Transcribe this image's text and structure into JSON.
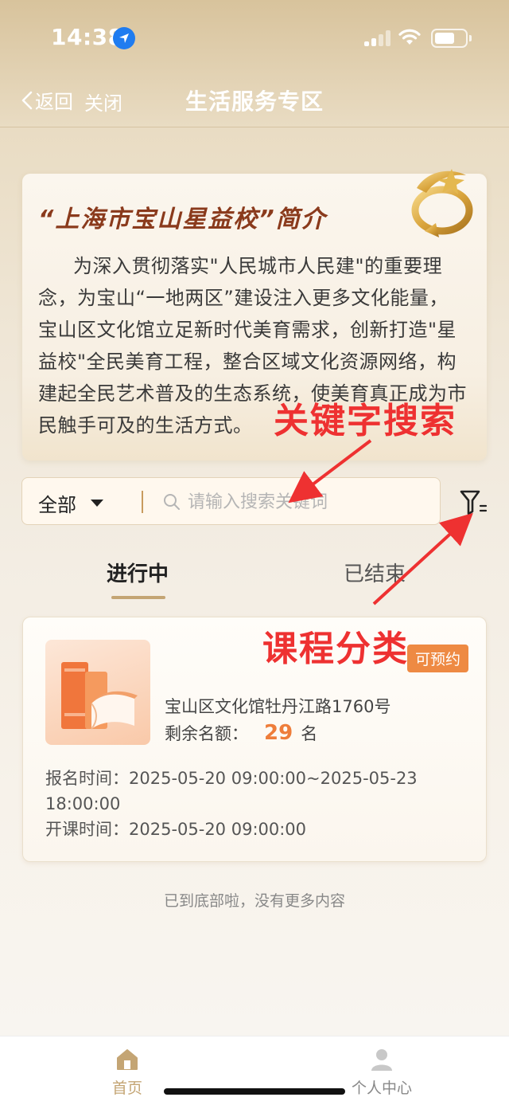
{
  "status_bar": {
    "time": "14:38"
  },
  "navbar": {
    "back_label": "返回",
    "close_label": "关闭",
    "title": "生活服务专区"
  },
  "intro": {
    "title": "“上海市宝山星益校”简介",
    "text": "为深入贯彻落实\"人民城市人民建\"的重要理念，为宝山“一地两区”建设注入更多文化能量，宝山区文化馆立足新时代美育需求，创新打造\"星益校\"全民美育工程，整合区域文化资源网络，构建起全民艺术普及的生态系统，使美育真正成为市民触手可及的生活方式。"
  },
  "search": {
    "category_selected": "全部",
    "placeholder": "请输入搜索关键词",
    "value": ""
  },
  "tabs": {
    "active": "进行中",
    "inactive": "已结束"
  },
  "annotations": {
    "keyword_search": "关键字搜索",
    "course_category": "课程分类"
  },
  "course": {
    "badge": "可预约",
    "location": "宝山区文化馆牡丹江路1760号",
    "remaining_label": "剩余名额：",
    "remaining_count": "29",
    "remaining_unit": "名",
    "reg_time_label": "报名时间：",
    "reg_time": "2025-05-20 09:00:00~2025-05-23 18:00:00",
    "start_time_label": "开课时间：",
    "start_time": "2025-05-20 09:00:00"
  },
  "end_hint": "已到底部啦，没有更多内容",
  "tabbar": {
    "home": "首页",
    "profile": "个人中心"
  },
  "colors": {
    "accent_gold": "#c4a574",
    "badge_orange": "#ee8a43",
    "annotation_red": "#ee3131",
    "title_brown": "#8a3a1c"
  }
}
